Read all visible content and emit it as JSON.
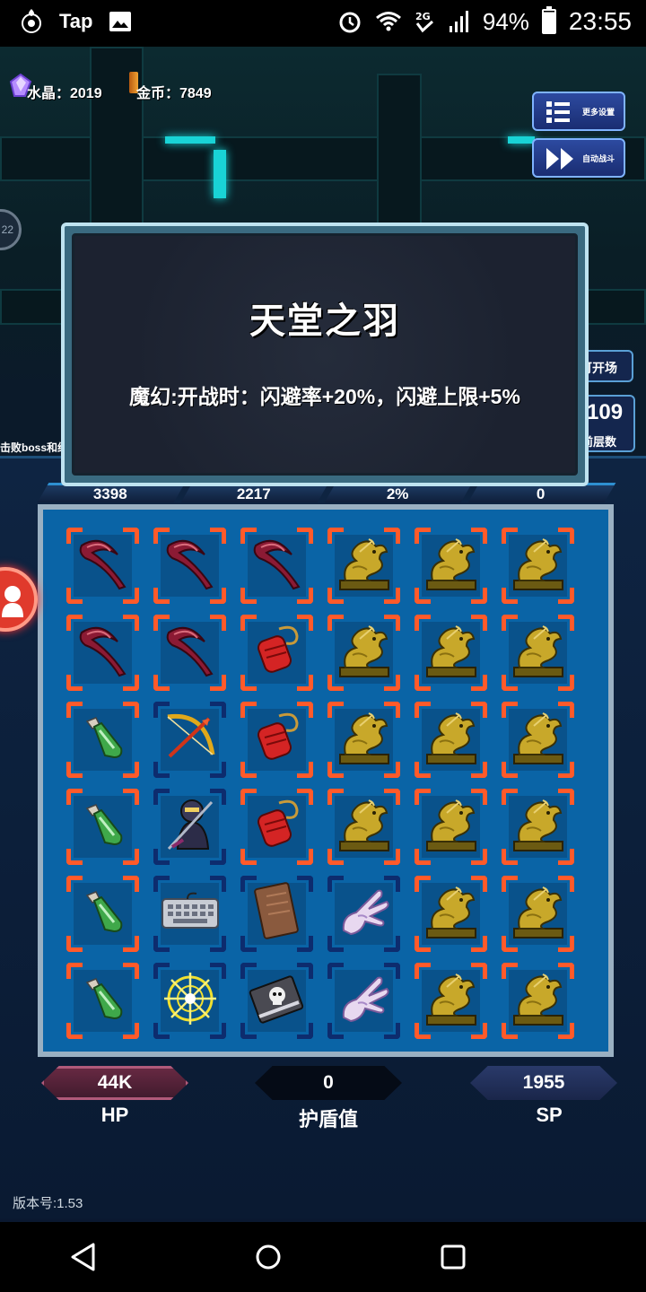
{
  "status_bar": {
    "app_name": "Tap",
    "battery": "94%",
    "time": "23:55",
    "signal": "2G"
  },
  "currency": {
    "crystal_label": "水晶：2019",
    "gold_label": "金币：7849"
  },
  "side_buttons": {
    "more_settings": "更多设置",
    "auto_battle": "自动战斗"
  },
  "round_left_label": "22",
  "peek": {
    "left_text": "击败boss和织",
    "right_open": "可开场",
    "right_number": "109",
    "right_floor": "前层数"
  },
  "popup": {
    "title": "天堂之羽",
    "description": "魔幻:开战时：闪避率+20%，闪避上限+5%"
  },
  "stats": [
    "3398",
    "2217",
    "2%",
    "0"
  ],
  "board": {
    "rows": [
      [
        "scythe",
        "scythe",
        "scythe",
        "dragon",
        "dragon",
        "dragon"
      ],
      [
        "scythe",
        "scythe",
        "talisman",
        "dragon",
        "dragon",
        "dragon"
      ],
      [
        "potion",
        "bow",
        "talisman",
        "dragon",
        "dragon",
        "dragon"
      ],
      [
        "potion",
        "ninja",
        "talisman",
        "dragon",
        "dragon",
        "dragon"
      ],
      [
        "potion",
        "keyboard",
        "book",
        "glove",
        "dragon",
        "dragon"
      ],
      [
        "potion",
        "sigil",
        "skull-book",
        "glove",
        "dragon",
        "dragon"
      ]
    ],
    "frame_colors": [
      [
        "orange",
        "orange",
        "orange",
        "orange",
        "orange",
        "orange"
      ],
      [
        "orange",
        "orange",
        "orange",
        "orange",
        "orange",
        "orange"
      ],
      [
        "orange",
        "blue",
        "orange",
        "orange",
        "orange",
        "orange"
      ],
      [
        "orange",
        "blue",
        "orange",
        "orange",
        "orange",
        "orange"
      ],
      [
        "orange",
        "blue",
        "blue",
        "blue",
        "orange",
        "orange"
      ],
      [
        "orange",
        "blue",
        "blue",
        "blue",
        "orange",
        "orange"
      ]
    ]
  },
  "bottom": {
    "hp_value": "44K",
    "hp_label": "HP",
    "shield_value": "0",
    "shield_label": "护盾值",
    "sp_value": "1955",
    "sp_label": "SP"
  },
  "version": "版本号:1.53",
  "colors": {
    "accent_cyan": "#19d3d6",
    "corner_orange": "#ff5a2a",
    "corner_blue": "#0d2c6e",
    "board_blue": "#0a64a6"
  }
}
